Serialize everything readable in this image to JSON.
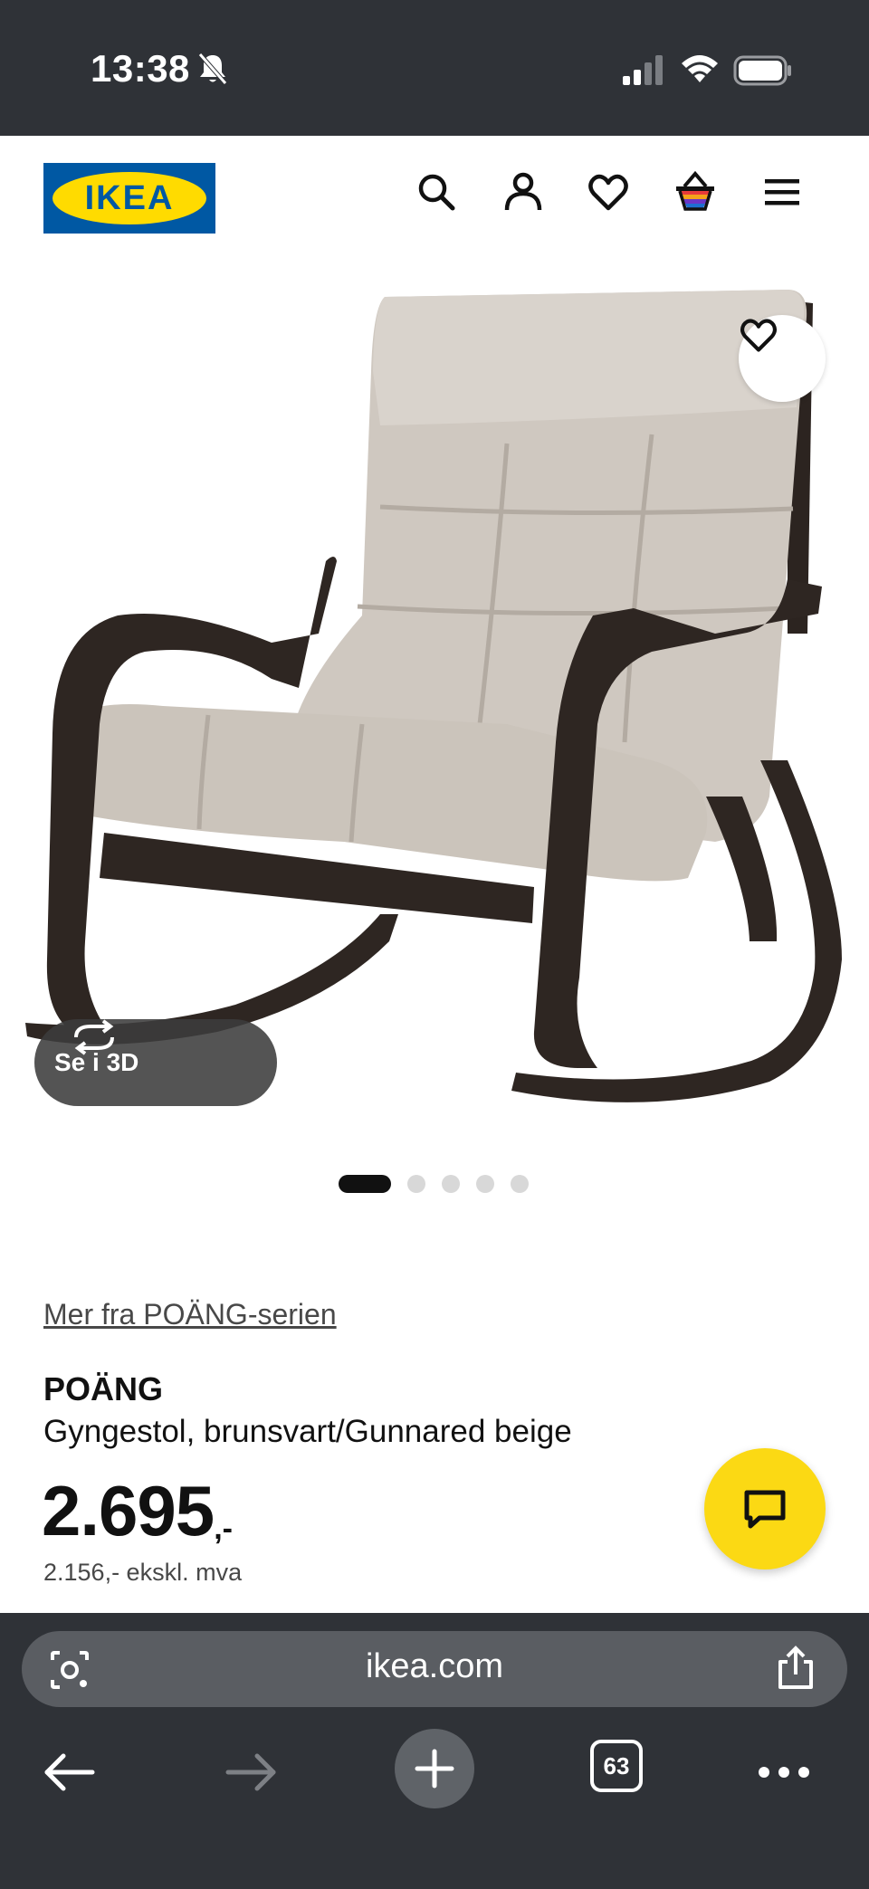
{
  "status_bar": {
    "time": "13:38"
  },
  "header": {
    "logo_text": "IKEA",
    "icons": [
      "search-icon",
      "account-icon",
      "heart-icon",
      "cart-icon",
      "menu-icon"
    ]
  },
  "gallery": {
    "view_3d_label": "Se i 3D",
    "active_index": 0,
    "image_count": 5
  },
  "product": {
    "series_link": "Mer fra POÄNG-serien",
    "name": "POÄNG",
    "description": "Gyngestol, brunsvart/Gunnared beige",
    "price_integer": "2.695",
    "price_suffix": ",-",
    "price_ex_vat": "2.156,- ekskl. mva"
  },
  "browser": {
    "url": "ikea.com",
    "tab_count": "63"
  },
  "colors": {
    "brand_blue": "#0058a3",
    "brand_yellow": "#ffdb00",
    "chat_yellow": "#fbd914",
    "chrome_dark": "#2f3237"
  }
}
